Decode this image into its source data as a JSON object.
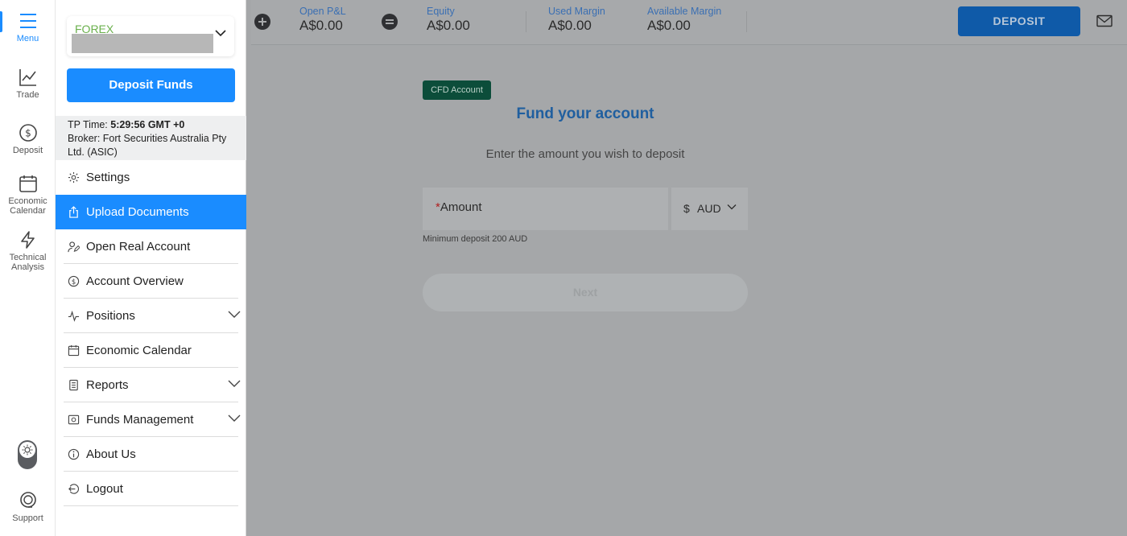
{
  "rail": {
    "items": [
      {
        "label": "Menu",
        "icon": "hamburger-icon"
      },
      {
        "label": "Trade",
        "icon": "chart-line-icon"
      },
      {
        "label": "Deposit",
        "icon": "dollar-circle-icon"
      },
      {
        "label": "Economic Calendar",
        "icon": "calendar-icon"
      },
      {
        "label": "Technical Analysis",
        "icon": "lightning-icon"
      }
    ],
    "support_label": "Support"
  },
  "panel": {
    "account_type": "FOREX",
    "deposit_funds_label": "Deposit Funds",
    "tp_time_label": "TP Time:",
    "tp_time_value": "5:29:56 GMT +0",
    "broker_text": "Broker: Fort Securities Australia Pty Ltd. (ASIC)",
    "menu": [
      {
        "label": "Settings",
        "icon": "gear-icon"
      },
      {
        "label": "Upload Documents",
        "icon": "upload-icon"
      },
      {
        "label": "Open Real Account",
        "icon": "user-edit-icon"
      },
      {
        "label": "Account Overview",
        "icon": "dollar-refresh-icon"
      },
      {
        "label": "Positions",
        "icon": "pulse-icon"
      },
      {
        "label": "Economic Calendar",
        "icon": "calendar-icon"
      },
      {
        "label": "Reports",
        "icon": "document-icon"
      },
      {
        "label": "Funds Management",
        "icon": "safe-icon"
      },
      {
        "label": "About Us",
        "icon": "info-icon"
      },
      {
        "label": "Logout",
        "icon": "logout-icon"
      }
    ]
  },
  "topbar": {
    "open_pnl_label": "Open P&L",
    "open_pnl_value": "A$0.00",
    "equity_label": "Equity",
    "equity_value": "A$0.00",
    "used_margin_label": "Used Margin",
    "used_margin_value": "A$0.00",
    "available_margin_label": "Available Margin",
    "available_margin_value": "A$0.00",
    "deposit_label": "DEPOSIT"
  },
  "main": {
    "badge": "CFD Account",
    "title": "Fund your account",
    "subtitle": "Enter the amount you wish to deposit",
    "amount_required_mark": "*",
    "amount_label": "Amount",
    "currency_symbol": "$",
    "currency_code": "AUD",
    "min_deposit": "Minimum deposit 200 AUD",
    "next_label": "Next"
  },
  "colors": {
    "accent": "#1a8cff",
    "overlay": "#a5a7a9",
    "badge_bg": "#0c4d3a",
    "title": "#205f9f"
  }
}
